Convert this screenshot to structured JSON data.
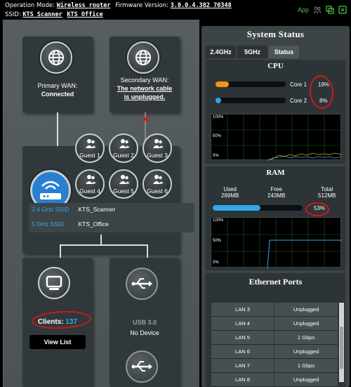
{
  "topbar": {
    "op_mode_label": "Operation Mode:",
    "op_mode_value": "Wireless router",
    "fw_label": "Firmware Version:",
    "fw_value": "3.0.0.4.382_70348",
    "ssid_label": "SSID:",
    "ssid_1": "KTS_Scanner",
    "ssid_2": "KTS_Office",
    "app_label": "App"
  },
  "network_map": {
    "primary_wan": {
      "title": "Primary WAN:",
      "status": "Connected"
    },
    "secondary_wan": {
      "title": "Secondary WAN:",
      "status": "The network cable is unplugged."
    },
    "guests": [
      "Guest 1",
      "Guest 2",
      "Guest 3",
      "Guest 4",
      "Guest 5",
      "Guest 6"
    ],
    "ssids": [
      {
        "band": "2.4 GHz SSID",
        "name": "KTS_Scanner"
      },
      {
        "band": "5 GHz SSID",
        "name": "KTS_Office"
      }
    ],
    "clients_label": "Clients:",
    "clients_count": "137",
    "view_list": "View List",
    "usb_label": "USB 3.0",
    "usb_status": "No Device"
  },
  "status": {
    "title": "System Status",
    "tabs": [
      "2.4GHz",
      "5GHz",
      "Status"
    ],
    "active_tab": "Status",
    "cpu": {
      "title": "CPU",
      "cores": [
        {
          "label": "Core 1",
          "percent": "19%",
          "value": 19,
          "color": "#f39219"
        },
        {
          "label": "Core 2",
          "percent": "8%",
          "value": 8,
          "color": "#2fa7ea"
        }
      ],
      "graph_labels": [
        "100%",
        "50%",
        "0%"
      ]
    },
    "ram": {
      "title": "RAM",
      "used_label": "Used",
      "used_value": "269MB",
      "free_label": "Free",
      "free_value": "243MB",
      "total_label": "Total",
      "total_value": "512MB",
      "percent": "53%",
      "value": 53,
      "color": "#2fa7ea",
      "graph_labels": [
        "100%",
        "50%",
        "0%"
      ]
    },
    "ethernet": {
      "title": "Ethernet Ports",
      "rows": [
        {
          "port": "LAN 3",
          "status": "Unplugged"
        },
        {
          "port": "LAN 4",
          "status": "Unplugged"
        },
        {
          "port": "LAN 5",
          "status": "1 Gbps"
        },
        {
          "port": "LAN 6",
          "status": "Unplugged"
        },
        {
          "port": "LAN 7",
          "status": "1 Gbps"
        },
        {
          "port": "LAN 8",
          "status": "Unplugged"
        }
      ]
    }
  },
  "colors": {
    "accent_blue": "#2fa7ea",
    "app_green": "#4ccd3c",
    "annotation_red": "#d01818"
  }
}
